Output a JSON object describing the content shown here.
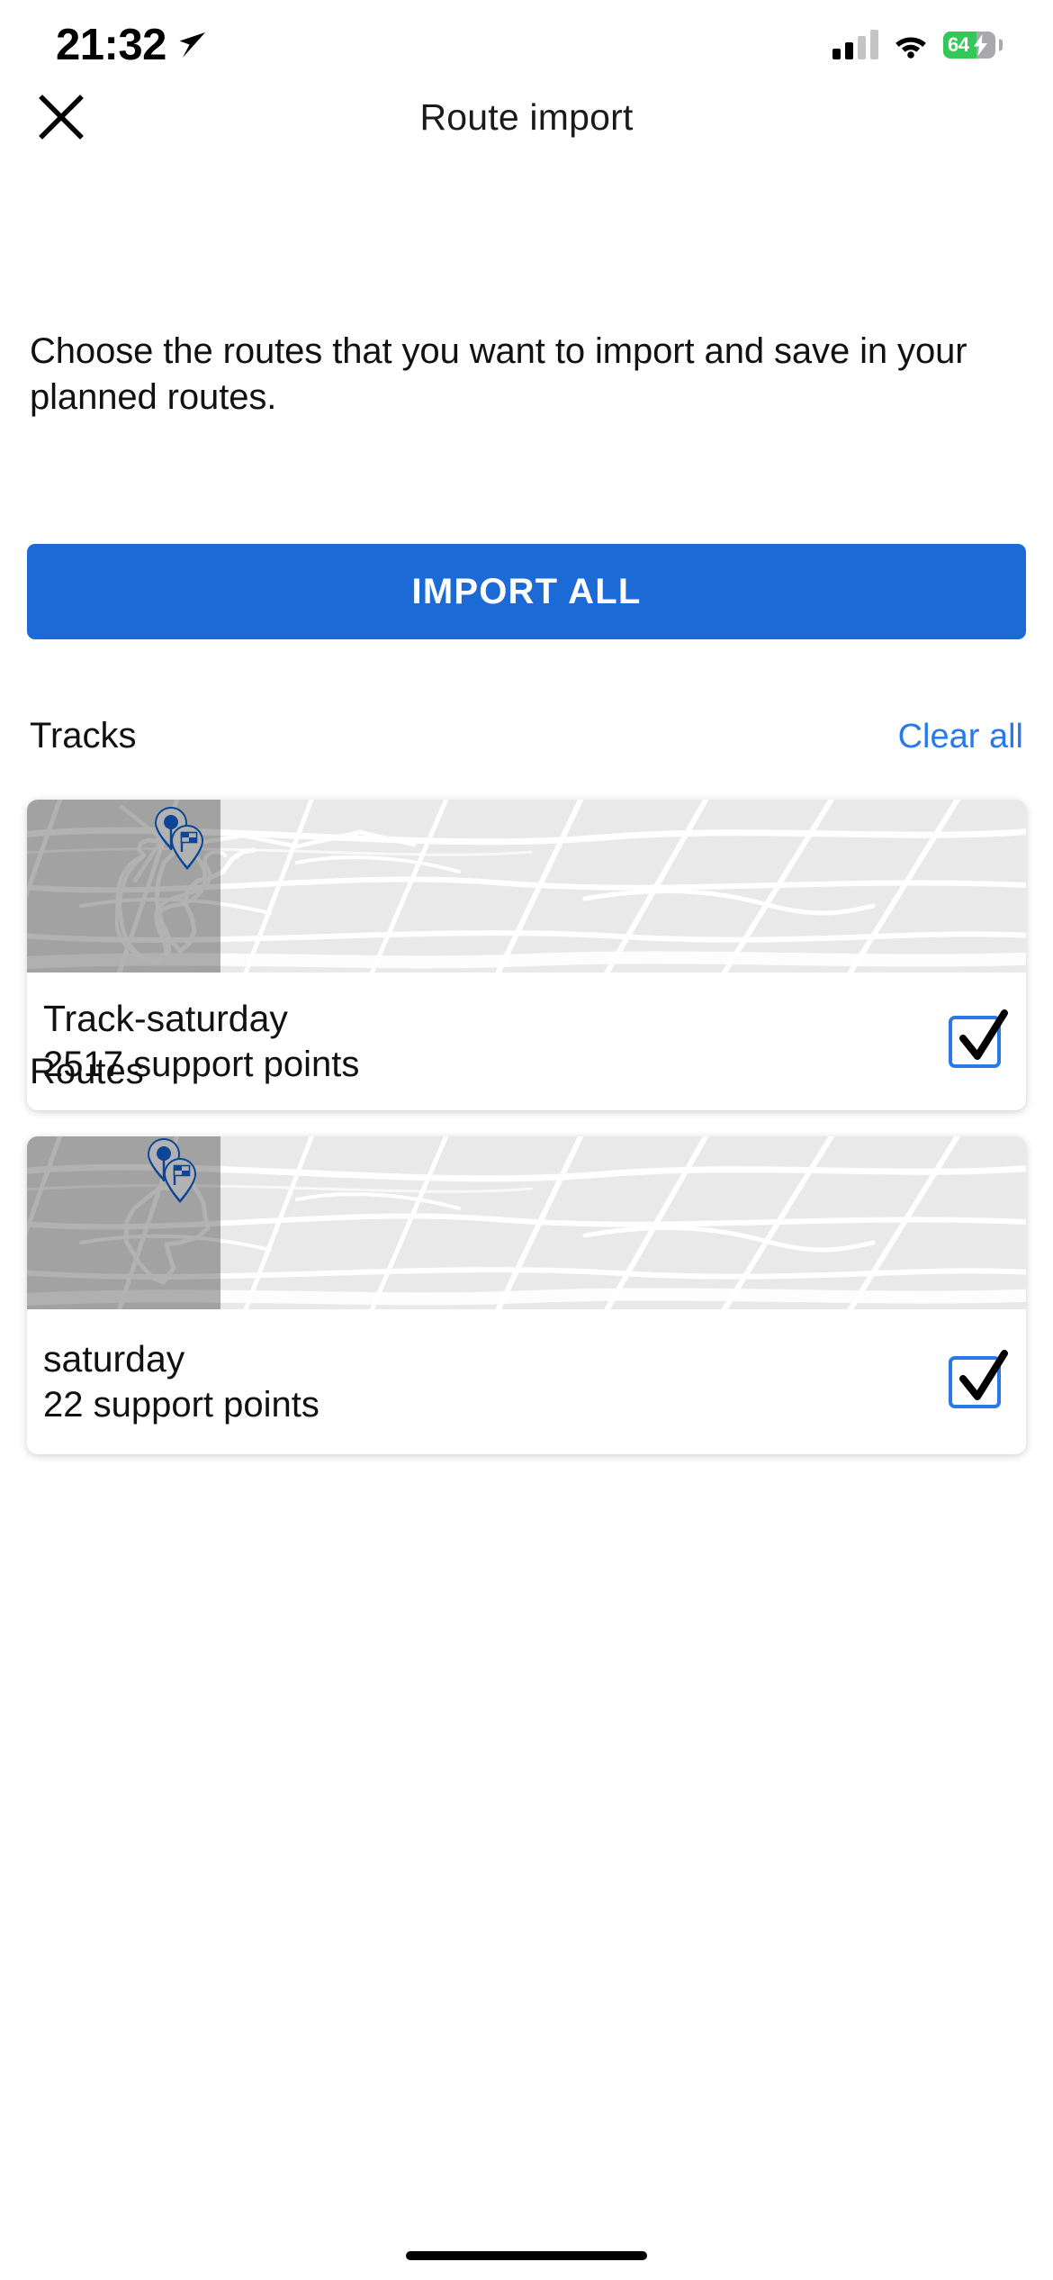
{
  "status_bar": {
    "time": "21:32",
    "location_icon": "location-arrow-icon",
    "signal_icon": "cellular-signal-icon",
    "signal_bars_filled": 2,
    "signal_bars_total": 4,
    "wifi_icon": "wifi-icon",
    "battery_percent": "64",
    "battery_level": 64,
    "battery_charging": true,
    "battery_color": "#34C759"
  },
  "header": {
    "close_icon": "close-icon",
    "title": "Route import"
  },
  "description": "Choose the routes that you want to import and save in your planned routes.",
  "import_all_button": {
    "label": "IMPORT ALL",
    "color": "#1B6AD6",
    "text_color": "#FFFFFF"
  },
  "sections": [
    {
      "id": "tracks",
      "title": "Tracks",
      "action_label": "Clear all",
      "action_color": "#2979E8",
      "items": [
        {
          "name": "Track-saturday",
          "support_points": "2517 support points",
          "checked": true,
          "checkbox_color": "#2979E8",
          "map": {
            "start_pin_icon": "map-start-pin-icon",
            "finish_pin_icon": "map-finish-flag-pin-icon",
            "pin_color": "#1565D8",
            "route_line_color": "#FFFFFF"
          }
        }
      ]
    },
    {
      "id": "routes",
      "title": "Routes",
      "action_label": "",
      "items": [
        {
          "name": "saturday",
          "support_points": "22 support points",
          "checked": true,
          "checkbox_color": "#2979E8",
          "map": {
            "start_pin_icon": "map-start-pin-icon",
            "finish_pin_icon": "map-finish-flag-pin-icon",
            "pin_color": "#1565D8",
            "route_line_color": "#FFFFFF"
          }
        }
      ]
    }
  ],
  "home_indicator": "home-indicator"
}
